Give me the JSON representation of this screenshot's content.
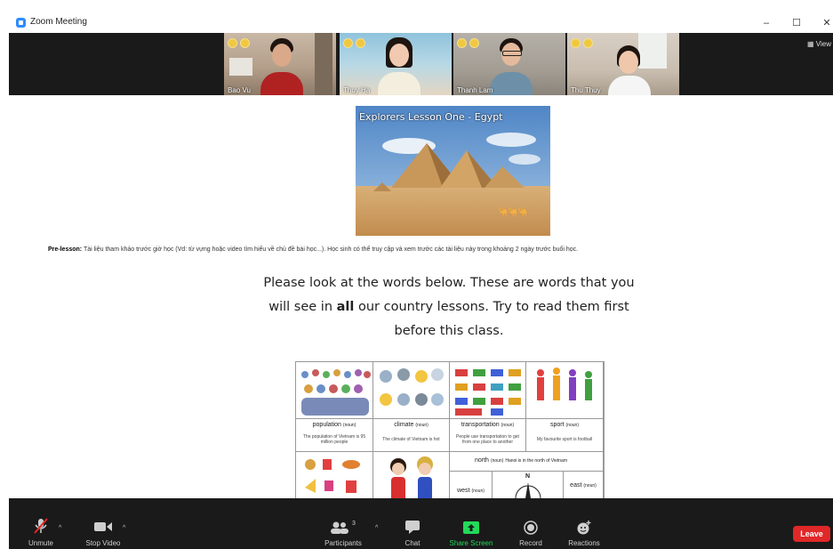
{
  "window": {
    "title": "Zoom Meeting",
    "minimize_symbol": "–",
    "maximize_symbol": "☐",
    "close_symbol": "✕"
  },
  "gallery": {
    "view_label": "View",
    "participants": [
      {
        "name": "Bao Vu",
        "shirt_color": "#b02222",
        "room_color": "#c8b8a6"
      },
      {
        "name": "Thuy Ha",
        "shirt_color": "#f3eedd",
        "room_color": "#8fc3dc"
      },
      {
        "name": "Thanh Lam",
        "shirt_color": "#6e8fa8",
        "room_color": "#b5b0a8"
      },
      {
        "name": "Thu Thuy",
        "shirt_color": "#f5f5f5",
        "room_color": "#d8cfc4"
      }
    ]
  },
  "content": {
    "hero_title": "Explorers Lesson One - Egypt",
    "prelesson_label": "Pre-lesson:",
    "prelesson_text": "Tài liệu tham khảo trước giờ học (Vd: từ vựng hoặc video tìm hiểu về chủ đề bài học...). Học sinh có thể truy cập và xem trước các tài liệu này trong khoảng 2 ngày trước buổi học.",
    "instruction_line1": "Please look at the words below. These are words that you",
    "instruction_line2_a": "will see in ",
    "instruction_line2_bold": "all",
    "instruction_line2_b": " our country lessons. Try to read them first",
    "instruction_line3": "before this class.",
    "words": [
      {
        "label": "population",
        "pos": "(noun)",
        "desc": "The population of Vietnam is 95 million people"
      },
      {
        "label": "climate",
        "pos": "(noun)",
        "desc": "The climate of Vietnam is hot"
      },
      {
        "label": "transportation",
        "pos": "(noun)",
        "desc": "People use transportation to get from one place to another"
      },
      {
        "label": "sport",
        "pos": "(noun)",
        "desc": "My favourite sport is football"
      }
    ],
    "north_label": "north",
    "north_pos": "(noun)",
    "north_desc": "Hanoi is in the north of Vietnam",
    "west_label": "west",
    "west_pos": "(noun)",
    "east_label": "east",
    "east_pos": "(noun)",
    "compass_letter": "N"
  },
  "toolbar": {
    "unmute": "Unmute",
    "stop_video": "Stop Video",
    "participants": "Participants",
    "participants_count": "3",
    "chat": "Chat",
    "share_screen": "Share Screen",
    "record": "Record",
    "reactions": "Reactions",
    "leave": "Leave",
    "share_color": "#23d959",
    "leave_color": "#e02828",
    "caret": "^"
  }
}
